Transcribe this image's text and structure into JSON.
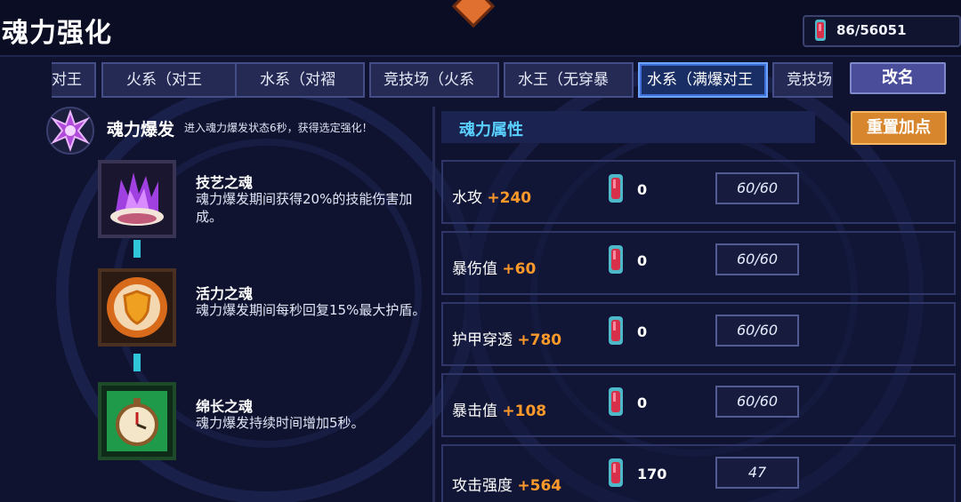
{
  "header": {
    "title": "魂力强化",
    "currency": "86/56051"
  },
  "tabs": [
    {
      "label": "对王",
      "active": false
    },
    {
      "label": "火系（对王",
      "active": false
    },
    {
      "label": "水系（对褶",
      "active": false
    },
    {
      "label": "竞技场（火系",
      "active": false
    },
    {
      "label": "水王（无穿暴",
      "active": false
    },
    {
      "label": "水系（满爆对王",
      "active": true
    },
    {
      "label": "竞技场",
      "active": false
    }
  ],
  "buttons": {
    "rename": "改名",
    "reset": "重置加点"
  },
  "burst": {
    "title": "魂力爆发",
    "description": "进入魂力爆发状态6秒，获得选定强化！"
  },
  "souls": [
    {
      "name": "技艺之魂",
      "description": "魂力爆发期间获得20%的技能伤害加成。",
      "icon": "purple-flame-shell-icon"
    },
    {
      "name": "活力之魂",
      "description": "魂力爆发期间每秒回复15%最大护盾。",
      "icon": "golden-shield-icon"
    },
    {
      "name": "绵长之魂",
      "description": "魂力爆发持续时间增加5秒。",
      "icon": "green-stopwatch-icon"
    }
  ],
  "attributes": {
    "title": "魂力属性",
    "rows": [
      {
        "name": "水攻",
        "bonus": "+240",
        "cost": "0",
        "progress": "60/60"
      },
      {
        "name": "暴伤值",
        "bonus": "+60",
        "cost": "0",
        "progress": "60/60"
      },
      {
        "name": "护甲穿透",
        "bonus": "+780",
        "cost": "0",
        "progress": "60/60"
      },
      {
        "name": "暴击值",
        "bonus": "+108",
        "cost": "0",
        "progress": "60/60"
      },
      {
        "name": "攻击强度",
        "bonus": "+564",
        "cost": "170",
        "progress": "47"
      }
    ]
  },
  "colors": {
    "accent_cyan": "#5ad0ff",
    "bonus_orange": "#ff9a2a",
    "reset_button": "#d8862e",
    "active_tab": "#6da3ff"
  }
}
